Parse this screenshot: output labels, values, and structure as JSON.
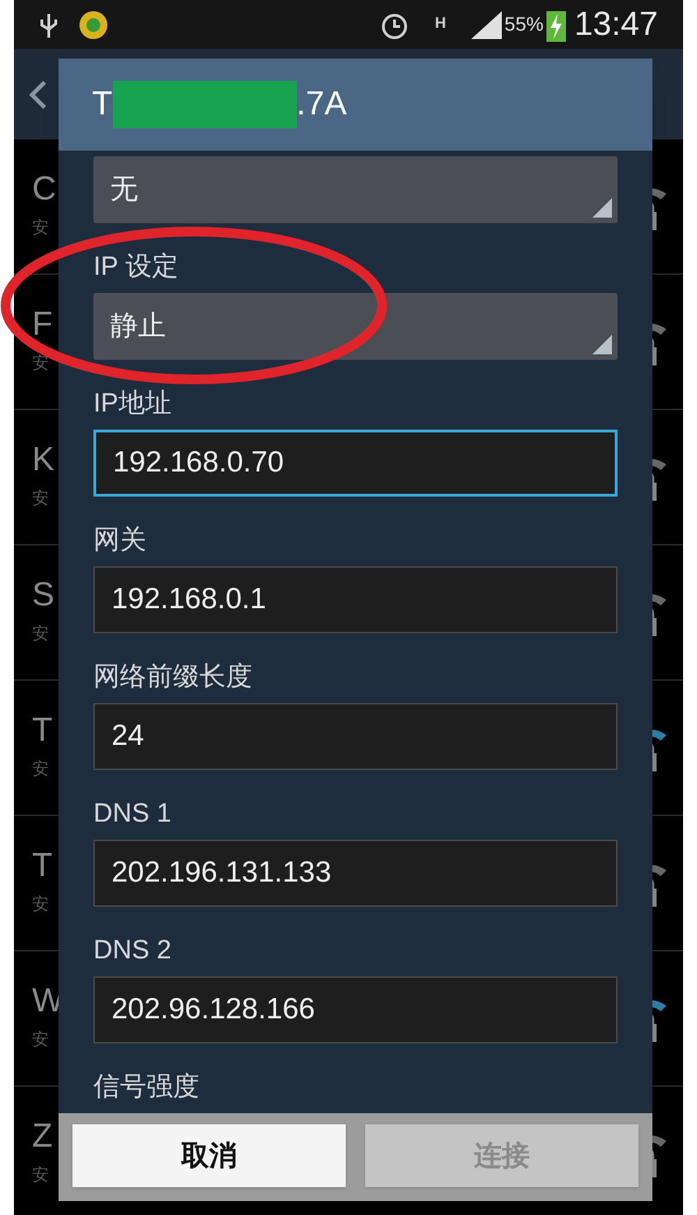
{
  "status_bar": {
    "battery": "55%",
    "time": "13:47",
    "network": "H"
  },
  "networks": [
    {
      "name": "C",
      "subtitle": "安",
      "color": "#6a6a6a"
    },
    {
      "name": "F",
      "subtitle": "安",
      "color": "#6a6a6a"
    },
    {
      "name": "K",
      "subtitle": "安",
      "color": "#6a6a6a"
    },
    {
      "name": "S",
      "subtitle": "安",
      "color": "#6a6a6a"
    },
    {
      "name": "T",
      "subtitle": "安",
      "color": "#2f7fa8"
    },
    {
      "name": "T",
      "subtitle": "安",
      "color": "#6a6a6a"
    },
    {
      "name": "W",
      "subtitle": "安",
      "color": "#2f7fa8"
    },
    {
      "name": "Z",
      "subtitle": "安",
      "color": "#6a6a6a"
    }
  ],
  "dialog": {
    "title_start": "T",
    "title_end": ".7A",
    "fields": [
      {
        "kind": "spinner",
        "value": "无"
      },
      {
        "kind": "spinner",
        "label": "IP 设定",
        "value": "静止"
      },
      {
        "kind": "input",
        "label": "IP地址",
        "value": "192.168.0.70",
        "focused": true
      },
      {
        "kind": "input",
        "label": "网关",
        "value": "192.168.0.1",
        "focused": false
      },
      {
        "kind": "input",
        "label": "网络前缀长度",
        "value": "24",
        "focused": false
      },
      {
        "kind": "input",
        "label": "DNS 1",
        "value": "202.196.131.133",
        "focused": false
      },
      {
        "kind": "input",
        "label": "DNS 2",
        "value": "202.96.128.166",
        "focused": false
      },
      {
        "kind": "label",
        "label": "信号强度"
      }
    ],
    "buttons": [
      {
        "label": "取消",
        "disabled": false
      },
      {
        "label": "连接",
        "disabled": true
      }
    ]
  }
}
